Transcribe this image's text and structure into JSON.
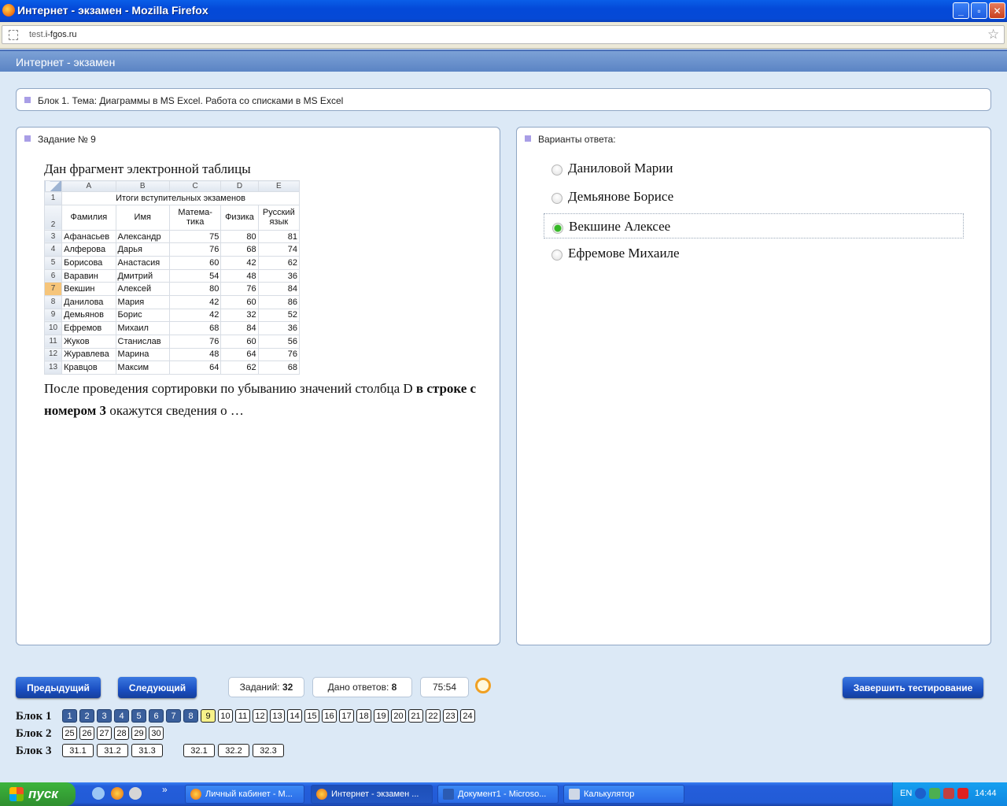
{
  "window": {
    "title": "Интернет - экзамен - Mozilla Firefox",
    "buttons": {
      "minimize": "_",
      "maximize": "▫",
      "close": "✕"
    }
  },
  "address": {
    "url_prefix": "test.",
    "url_host": "i-fgos.ru"
  },
  "app": {
    "header_title": "Интернет - экзамен"
  },
  "topic": {
    "label": "Блок 1. Тема: Диаграммы в MS Excel. Работа со списками в MS Excel"
  },
  "question": {
    "label": "Задание № 9",
    "intro": "Дан фрагмент электронной таблицы",
    "text_part1": "После проведения сортировки по убыванию значений столбца D ",
    "text_bold": "в строке с номером 3",
    "text_part2": " окажутся сведения о  …",
    "sheet": {
      "col_headers": [
        "A",
        "B",
        "C",
        "D",
        "E"
      ],
      "title_row": {
        "num": "1",
        "text": "Итоги вступительных экзаменов"
      },
      "header_row": {
        "num": "2",
        "cells": [
          "Фамилия",
          "Имя",
          "Матема-тика",
          "Физика",
          "Русский язык"
        ]
      },
      "rows": [
        {
          "num": "3",
          "a": "Афанасьев",
          "b": "Александр",
          "c": "75",
          "d": "80",
          "e": "81"
        },
        {
          "num": "4",
          "a": "Алферова",
          "b": "Дарья",
          "c": "76",
          "d": "68",
          "e": "74"
        },
        {
          "num": "5",
          "a": "Борисова",
          "b": "Анастасия",
          "c": "60",
          "d": "42",
          "e": "62"
        },
        {
          "num": "6",
          "a": "Варавин",
          "b": "Дмитрий",
          "c": "54",
          "d": "48",
          "e": "36"
        },
        {
          "num": "7",
          "a": "Векшин",
          "b": "Алексей",
          "c": "80",
          "d": "76",
          "e": "84"
        },
        {
          "num": "8",
          "a": "Данилова",
          "b": "Мария",
          "c": "42",
          "d": "60",
          "e": "86"
        },
        {
          "num": "9",
          "a": "Демьянов",
          "b": "Борис",
          "c": "42",
          "d": "32",
          "e": "52"
        },
        {
          "num": "10",
          "a": "Ефремов",
          "b": "Михаил",
          "c": "68",
          "d": "84",
          "e": "36"
        },
        {
          "num": "11",
          "a": "Жуков",
          "b": "Станислав",
          "c": "76",
          "d": "60",
          "e": "56"
        },
        {
          "num": "12",
          "a": "Журавлева",
          "b": "Марина",
          "c": "48",
          "d": "64",
          "e": "76"
        },
        {
          "num": "13",
          "a": "Кравцов",
          "b": "Максим",
          "c": "64",
          "d": "62",
          "e": "68"
        }
      ]
    }
  },
  "answers": {
    "label": "Варианты ответа:",
    "options": [
      "Даниловой Марии",
      "Демьянове Борисе",
      "Векшине Алексее",
      "Ефремове Михаиле"
    ],
    "selected": "Векшине Алексее"
  },
  "footer": {
    "prev_label": "Предыдущий",
    "next_label": "Следующий",
    "tasks_label": "Заданий:",
    "tasks_count": "32",
    "answered_label": "Дано ответов:",
    "answered_count": "8",
    "timer": "75:54",
    "finish_label": "Завершить тестирование",
    "blocks": [
      {
        "label": "Блок 1",
        "items": [
          "1",
          "2",
          "3",
          "4",
          "5",
          "6",
          "7",
          "8",
          "9",
          "10",
          "11",
          "12",
          "13",
          "14",
          "15",
          "16",
          "17",
          "18",
          "19",
          "20",
          "21",
          "22",
          "23",
          "24"
        ]
      },
      {
        "label": "Блок 2",
        "items": [
          "25",
          "26",
          "27",
          "28",
          "29",
          "30"
        ]
      },
      {
        "label": "Блок 3",
        "items": [
          "31.1",
          "31.2",
          "31.3",
          "32.1",
          "32.2",
          "32.3"
        ]
      }
    ],
    "answered_items": [
      "1",
      "2",
      "3",
      "4",
      "5",
      "6",
      "7",
      "8"
    ],
    "current_item": "9"
  },
  "taskbar": {
    "start_label": "пуск",
    "buttons": [
      "Личный кабинет - M...",
      "Интернет - экзамен ...",
      "Документ1 - Microso...",
      "Калькулятор"
    ],
    "active": "Интернет - экзамен ...",
    "lang": "EN",
    "time": "14:44",
    "quicklaunch_expand": "»"
  },
  "colors": {
    "accent": "#1a4fc2",
    "answered": "#3a5f9c",
    "current": "#f7f28a",
    "selected_radio": "#36b827"
  }
}
